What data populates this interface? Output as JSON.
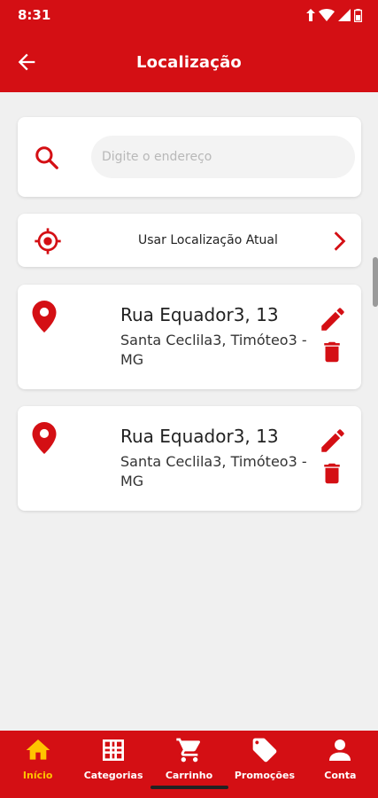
{
  "status_bar": {
    "time": "8:31"
  },
  "app_bar": {
    "title": "Localização",
    "back_icon": "arrow-left-icon"
  },
  "search": {
    "placeholder": "Digite o endereço",
    "value": "",
    "icon": "search-icon"
  },
  "current_location": {
    "label": "Usar Localização Atual",
    "icon": "target-icon",
    "chevron": "chevron-right-icon"
  },
  "addresses": [
    {
      "street": "Rua Equador3, 13",
      "detail": "Santa Ceclila3, Timóteo3 - MG"
    },
    {
      "street": "Rua Equador3, 13",
      "detail": "Santa Ceclila3, Timóteo3 - MG"
    }
  ],
  "bottom_nav": {
    "items": [
      {
        "label": "Início",
        "icon": "home-icon",
        "active": true
      },
      {
        "label": "Categorias",
        "icon": "grid-icon",
        "active": false
      },
      {
        "label": "Carrinho",
        "icon": "cart-icon",
        "active": false
      },
      {
        "label": "Promoções",
        "icon": "tag-icon",
        "active": false
      },
      {
        "label": "Conta",
        "icon": "person-icon",
        "active": false
      }
    ]
  },
  "colors": {
    "brand_red": "#d40f14",
    "active_yellow": "#ffc400",
    "background": "#f0f0f0"
  }
}
